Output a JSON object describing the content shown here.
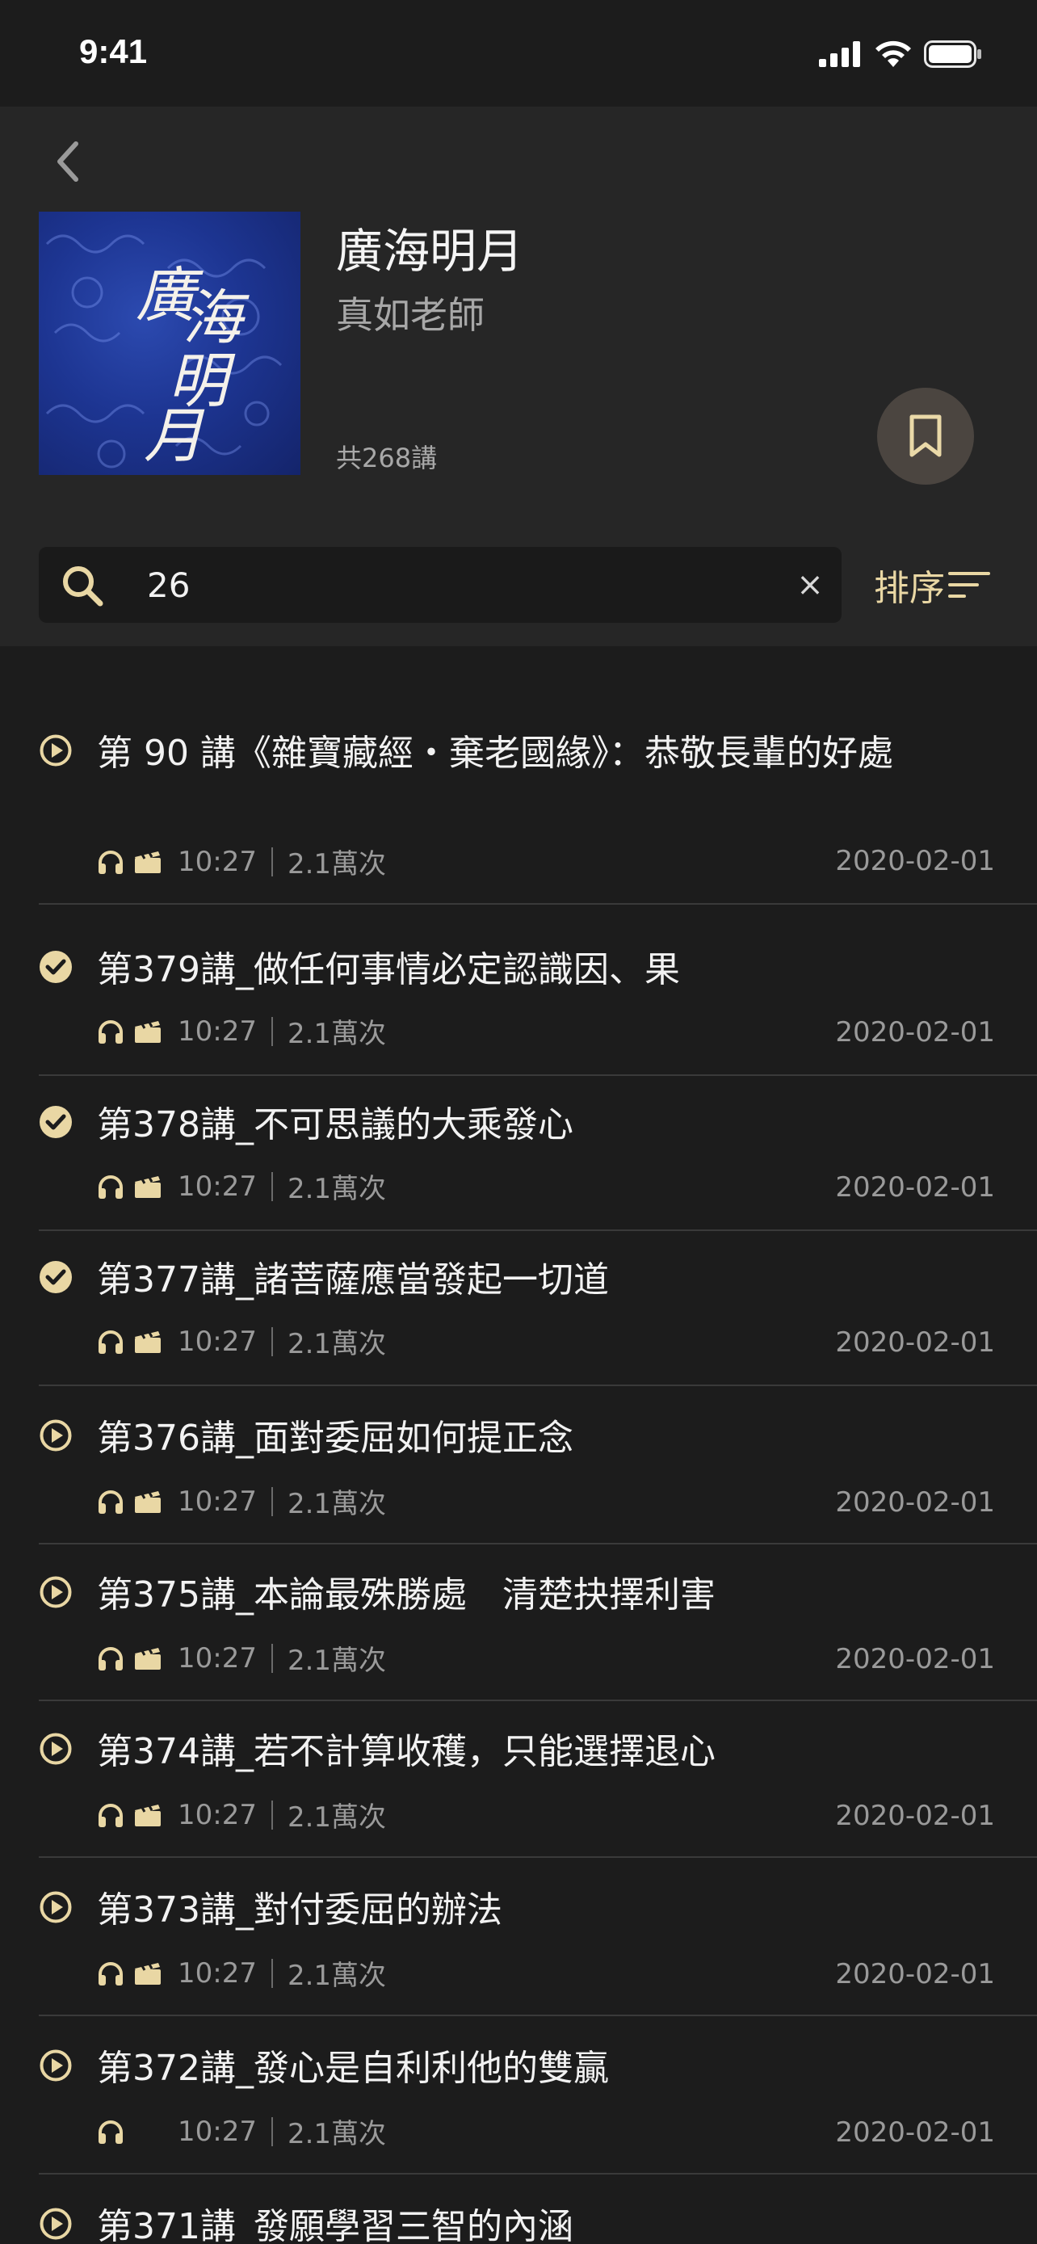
{
  "status_bar": {
    "time": "9:41"
  },
  "album": {
    "cover_text": [
      "廣",
      "海",
      "明",
      "月"
    ],
    "title": "廣海明月",
    "author": "真如老師",
    "count": "共268講"
  },
  "search": {
    "value": "26",
    "clear_label": "×"
  },
  "sort": {
    "label": "排序"
  },
  "accent_color": "#e9d7a4",
  "episodes": [
    {
      "title": "第 90 講《雜寶藏經・棄老國緣》：恭敬長輩的好處",
      "status": "play",
      "has_video": true,
      "duration": "10:27",
      "plays": "2.1萬次",
      "date": "2020-02-01"
    },
    {
      "title": "第379講_做任何事情必定認識因、果",
      "status": "done",
      "has_video": true,
      "duration": "10:27",
      "plays": "2.1萬次",
      "date": "2020-02-01"
    },
    {
      "title": "第378講_不可思議的大乘發心",
      "status": "done",
      "has_video": true,
      "duration": "10:27",
      "plays": "2.1萬次",
      "date": "2020-02-01"
    },
    {
      "title": "第377講_諸菩薩應當發起一切道",
      "status": "done",
      "has_video": true,
      "duration": "10:27",
      "plays": "2.1萬次",
      "date": "2020-02-01"
    },
    {
      "title": "第376講_面對委屈如何提正念",
      "status": "play",
      "has_video": true,
      "duration": "10:27",
      "plays": "2.1萬次",
      "date": "2020-02-01"
    },
    {
      "title": "第375講_本論最殊勝處　清楚抉擇利害",
      "status": "play",
      "has_video": true,
      "duration": "10:27",
      "plays": "2.1萬次",
      "date": "2020-02-01"
    },
    {
      "title": "第374講_若不計算收穫，只能選擇退心",
      "status": "play",
      "has_video": true,
      "duration": "10:27",
      "plays": "2.1萬次",
      "date": "2020-02-01"
    },
    {
      "title": "第373講_對付委屈的辦法",
      "status": "play",
      "has_video": true,
      "duration": "10:27",
      "plays": "2.1萬次",
      "date": "2020-02-01"
    },
    {
      "title": "第372講_發心是自利利他的雙贏",
      "status": "play",
      "has_video": false,
      "duration": "10:27",
      "plays": "2.1萬次",
      "date": "2020-02-01"
    },
    {
      "title": "第371講_發願學習三智的內涵",
      "status": "play",
      "has_video": false,
      "duration": "",
      "plays": "",
      "date": ""
    }
  ]
}
